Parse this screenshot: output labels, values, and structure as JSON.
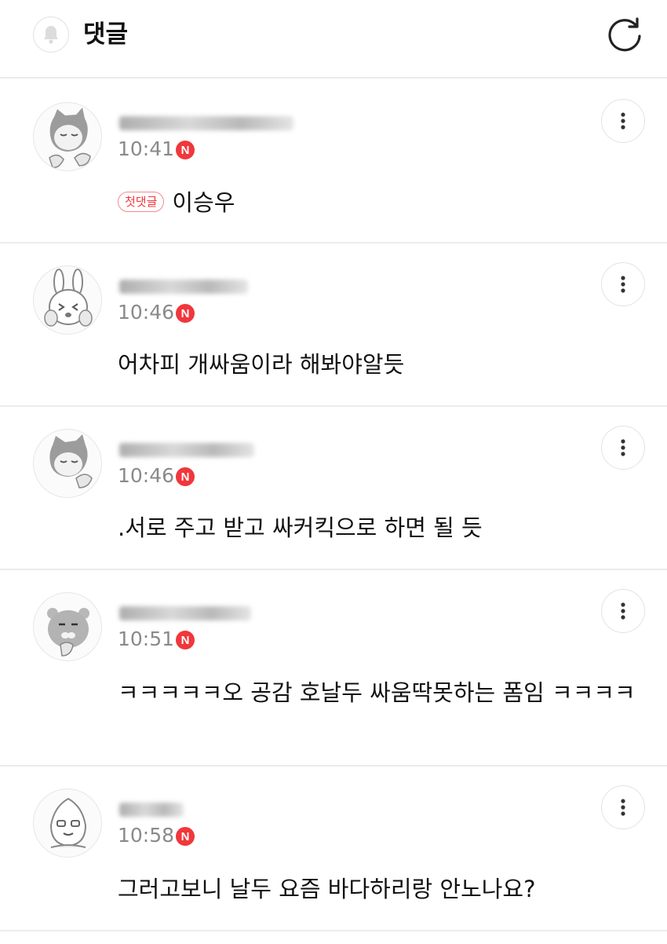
{
  "header": {
    "title": "댓글"
  },
  "comments": [
    {
      "time": "10:41",
      "badge": "N",
      "first_label": "첫댓글",
      "text": "이승우",
      "avatar": "cat-character-icon"
    },
    {
      "time": "10:46",
      "badge": "N",
      "text": "어차피 개싸움이라 해봐야알듯",
      "avatar": "rabbit-character-icon"
    },
    {
      "time": "10:46",
      "badge": "N",
      "text": ".서로 주고 받고 싸커킥으로 하면 될 듯",
      "avatar": "cat-character-icon"
    },
    {
      "time": "10:51",
      "badge": "N",
      "text": "ㅋㅋㅋㅋㅋ오 공감 호날두 싸움딱못하는 폼임 ㅋㅋㅋㅋ",
      "avatar": "lion-character-icon"
    },
    {
      "time": "10:58",
      "badge": "N",
      "text": "그러고보니 날두 요즘 바다하리랑 안노나요?",
      "avatar": "peach-character-icon"
    }
  ]
}
